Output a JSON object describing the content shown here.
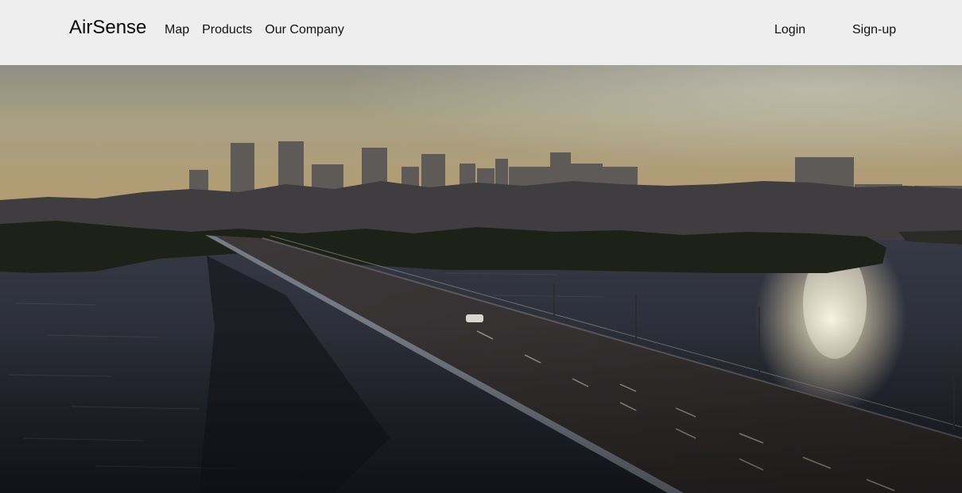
{
  "header": {
    "brand": "AirSense",
    "nav": [
      {
        "label": "Map"
      },
      {
        "label": "Products"
      },
      {
        "label": "Our Company"
      }
    ],
    "login_label": "Login",
    "signup_label": "Sign-up",
    "background_color": "#eeeeee"
  },
  "hero": {
    "scene": "city-skyline-bridge-sunset",
    "sky_color": "#a49a7a",
    "water_color": "#2a2f3a"
  }
}
